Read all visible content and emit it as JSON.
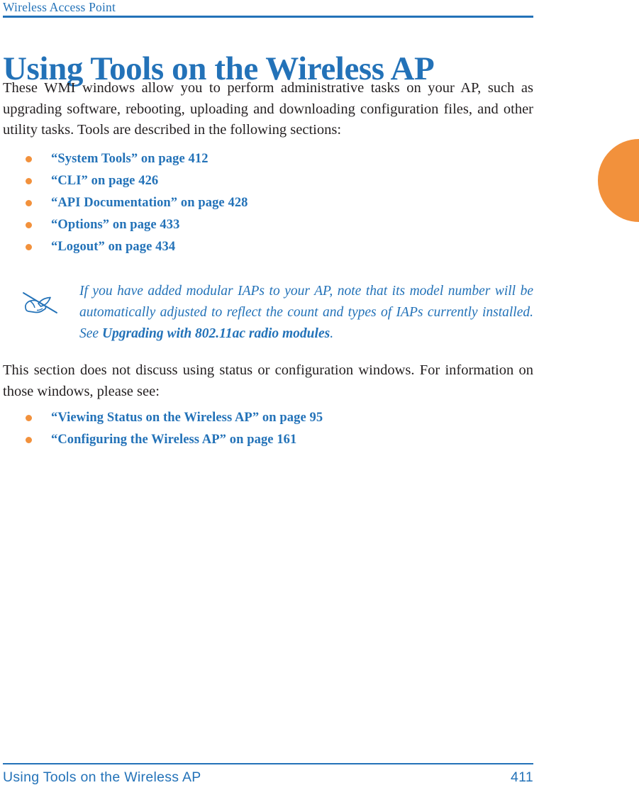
{
  "header": {
    "running_head": "Wireless Access Point"
  },
  "title": "Using Tools on the Wireless AP",
  "intro_paragraph": "These WMI windows allow you to perform administrative tasks on your AP, such as upgrading software, rebooting, uploading and downloading configuration files, and other utility tasks. Tools are described in the following sections:",
  "tools_links": [
    {
      "label": "“System Tools” on page 412"
    },
    {
      "label": "“CLI” on page 426"
    },
    {
      "label": "“API Documentation” on page 428"
    },
    {
      "label": "“Options” on page 433"
    },
    {
      "label": "“Logout” on page 434"
    }
  ],
  "note": {
    "icon": "note-pencil-icon",
    "text_part1": "If you have added modular IAPs to your AP, note that its model number will be automatically adjusted to reflect the count and types of IAPs currently installed. See ",
    "text_bold": "Upgrading with 802.11ac radio modules",
    "text_part2": "."
  },
  "second_paragraph": "This section does not discuss using status or configuration windows. For information on those windows, please see:",
  "status_links": [
    {
      "label": "“Viewing Status on the Wireless AP” on page 95"
    },
    {
      "label": "“Configuring the Wireless AP” on page 161"
    }
  ],
  "footer": {
    "title": "Using Tools on the Wireless AP",
    "page_number": "411"
  },
  "colors": {
    "accent_blue": "#2372b8",
    "accent_orange": "#f2913c",
    "body_text": "#231f20"
  }
}
